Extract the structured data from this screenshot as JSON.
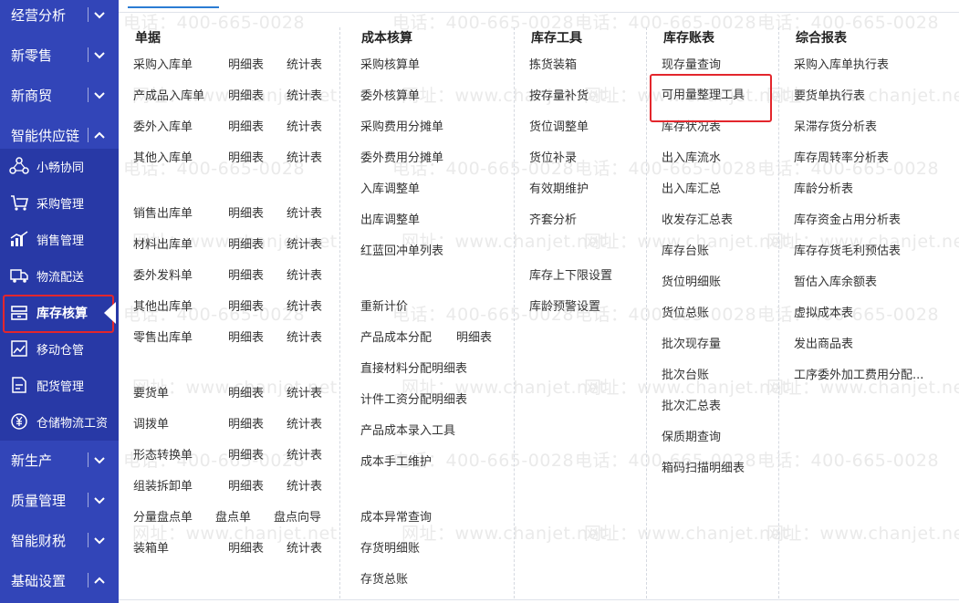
{
  "sidebar": {
    "top_items": [
      {
        "label": "经营分析",
        "expanded": false
      },
      {
        "label": "新零售",
        "expanded": false
      },
      {
        "label": "新商贸",
        "expanded": false
      },
      {
        "label": "智能供应链",
        "expanded": true
      }
    ],
    "sub_items": [
      {
        "label": "小畅协同",
        "icon": "collaboration-icon"
      },
      {
        "label": "采购管理",
        "icon": "purchase-cart-icon"
      },
      {
        "label": "销售管理",
        "icon": "sales-chart-icon"
      },
      {
        "label": "物流配送",
        "icon": "delivery-truck-icon"
      },
      {
        "label": "库存核算",
        "icon": "inventory-stack-icon",
        "active": true
      },
      {
        "label": "移动仓管",
        "icon": "mobile-warehouse-icon"
      },
      {
        "label": "配货管理",
        "icon": "distribution-icon"
      },
      {
        "label": "仓储物流工资",
        "icon": "salary-yen-icon"
      }
    ],
    "bottom_items": [
      {
        "label": "新生产",
        "expanded": false
      },
      {
        "label": "质量管理",
        "expanded": false
      },
      {
        "label": "智能财税",
        "expanded": false
      },
      {
        "label": "基础设置",
        "expanded": true
      }
    ]
  },
  "columns": {
    "documents": {
      "header": "单据",
      "rows": [
        {
          "name": "采购入库单",
          "detail": "明细表",
          "stats": "统计表"
        },
        {
          "name": "产成品入库单",
          "detail": "明细表",
          "stats": "统计表"
        },
        {
          "name": "委外入库单",
          "detail": "明细表",
          "stats": "统计表"
        },
        {
          "name": "其他入库单",
          "detail": "明细表",
          "stats": "统计表"
        },
        {
          "name": "销售出库单",
          "detail": "明细表",
          "stats": "统计表"
        },
        {
          "name": "材料出库单",
          "detail": "明细表",
          "stats": "统计表"
        },
        {
          "name": "委外发料单",
          "detail": "明细表",
          "stats": "统计表"
        },
        {
          "name": "其他出库单",
          "detail": "明细表",
          "stats": "统计表"
        },
        {
          "name": "零售出库单",
          "detail": "明细表",
          "stats": "统计表"
        },
        {
          "name": "要货单",
          "detail": "明细表",
          "stats": "统计表"
        },
        {
          "name": "调拨单",
          "detail": "明细表",
          "stats": "统计表"
        },
        {
          "name": "形态转换单",
          "detail": "明细表",
          "stats": "统计表"
        },
        {
          "name": "组装拆卸单",
          "detail": "明细表",
          "stats": "统计表"
        },
        {
          "name": "分量盘点单",
          "detail": "盘点单",
          "stats": "盘点向导"
        },
        {
          "name": "装箱单",
          "detail": "明细表",
          "stats": "统计表"
        }
      ]
    },
    "cost": {
      "header": "成本核算",
      "items": [
        "采购核算单",
        "委外核算单",
        "采购费用分摊单",
        "委外费用分摊单",
        "入库调整单",
        "出库调整单",
        "红蓝回冲单列表",
        "重新计价",
        "产品成本分配",
        "直接材料分配明细表",
        "计件工资分配明细表",
        "产品成本录入工具",
        "成本手工维护",
        "成本异常查询",
        "存货明细账",
        "存货总账"
      ],
      "alloc_detail": "明细表"
    },
    "tools": {
      "header": "库存工具",
      "items": [
        "拣货装箱",
        "按存量补货",
        "货位调整单",
        "货位补录",
        "有效期维护",
        "齐套分析",
        "库存上下限设置",
        "库龄预警设置"
      ]
    },
    "ledger": {
      "header": "库存账表",
      "items": [
        "现存量查询",
        "可用量整理工具",
        "库存状况表",
        "出入库流水",
        "出入库汇总",
        "收发存汇总表",
        "库存台账",
        "货位明细账",
        "货位总账",
        "批次现存量",
        "批次台账",
        "批次汇总表",
        "保质期查询",
        "箱码扫描明细表"
      ]
    },
    "reports": {
      "header": "综合报表",
      "items": [
        "采购入库单执行表",
        "要货单执行表",
        "呆滞存货分析表",
        "库存周转率分析表",
        "库龄分析表",
        "库存资金占用分析表",
        "库存存货毛利预估表",
        "暂估入库余额表",
        "虚拟成本表",
        "发出商品表",
        "工序委外加工费用分配..."
      ]
    }
  },
  "watermark": {
    "phone": "电话：400-665-0028",
    "site": "网址：www.chanjet.net"
  },
  "colors": {
    "sidebar_bg": "#3245b8",
    "sidebar_subpanel": "#2839a6",
    "highlight_red": "#e3262c",
    "tab_accent": "#2b7cd3"
  }
}
